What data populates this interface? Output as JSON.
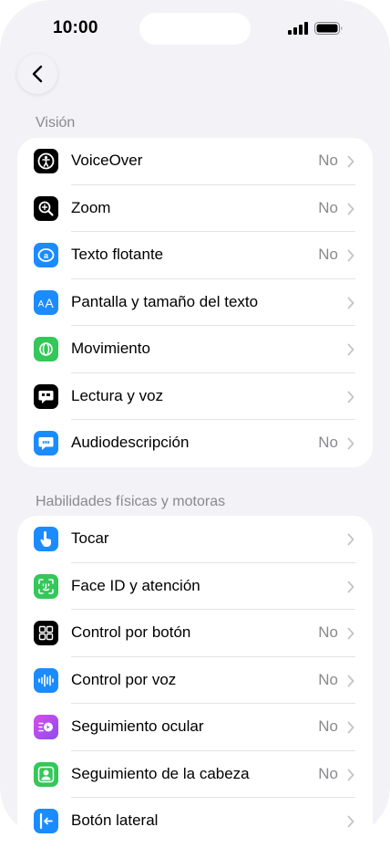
{
  "status_bar": {
    "time": "10:00"
  },
  "nav": {
    "back_icon": "chevron-left-icon"
  },
  "sections": [
    {
      "header": "Visión",
      "items": [
        {
          "label": "VoiceOver",
          "value": "No",
          "icon": "voiceover-icon",
          "color": "#000000"
        },
        {
          "label": "Zoom",
          "value": "No",
          "icon": "zoom-icon",
          "color": "#000000"
        },
        {
          "label": "Texto flotante",
          "value": "No",
          "icon": "hover-text-icon",
          "color": "#1a8cff"
        },
        {
          "label": "Pantalla y tamaño del texto",
          "value": "",
          "icon": "text-size-icon",
          "color": "#1a8cff"
        },
        {
          "label": "Movimiento",
          "value": "",
          "icon": "motion-icon",
          "color": "#34c759"
        },
        {
          "label": "Lectura y voz",
          "value": "",
          "icon": "spoken-content-icon",
          "color": "#000000"
        },
        {
          "label": "Audiodescripción",
          "value": "No",
          "icon": "audio-description-icon",
          "color": "#1a8cff"
        }
      ]
    },
    {
      "header": "Habilidades físicas y motoras",
      "items": [
        {
          "label": "Tocar",
          "value": "",
          "icon": "touch-icon",
          "color": "#1a8cff"
        },
        {
          "label": "Face ID y atención",
          "value": "",
          "icon": "face-id-icon",
          "color": "#34c759"
        },
        {
          "label": "Control por botón",
          "value": "No",
          "icon": "switch-control-icon",
          "color": "#000000"
        },
        {
          "label": "Control por voz",
          "value": "No",
          "icon": "voice-control-icon",
          "color": "#1a8cff"
        },
        {
          "label": "Seguimiento ocular",
          "value": "No",
          "icon": "eye-tracking-icon",
          "color": "#b14cf0"
        },
        {
          "label": "Seguimiento de la cabeza",
          "value": "No",
          "icon": "head-tracking-icon",
          "color": "#34c759"
        },
        {
          "label": "Botón lateral",
          "value": "",
          "icon": "side-button-icon",
          "color": "#1a8cff"
        }
      ]
    }
  ]
}
